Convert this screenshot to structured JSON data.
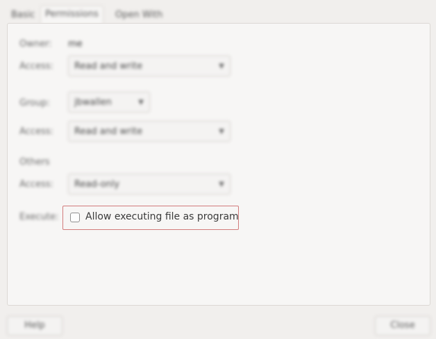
{
  "tabs": [
    {
      "label": "Basic"
    },
    {
      "label": "Permissions"
    },
    {
      "label": "Open With"
    }
  ],
  "owner": {
    "label": "Owner:",
    "value": "me"
  },
  "owner_access": {
    "label": "Access:",
    "value": "Read and write"
  },
  "group": {
    "label": "Group:",
    "value": "jbwallen"
  },
  "group_access": {
    "label": "Access:",
    "value": "Read and write"
  },
  "others": {
    "label": "Others"
  },
  "others_access": {
    "label": "Access:",
    "value": "Read-only"
  },
  "execute": {
    "label": "Execute:",
    "checkbox_label": "Allow executing file as program",
    "checked": false
  },
  "buttons": {
    "help": "Help",
    "close": "Close"
  },
  "icons": {
    "dropdown": "chevron-down-icon"
  }
}
